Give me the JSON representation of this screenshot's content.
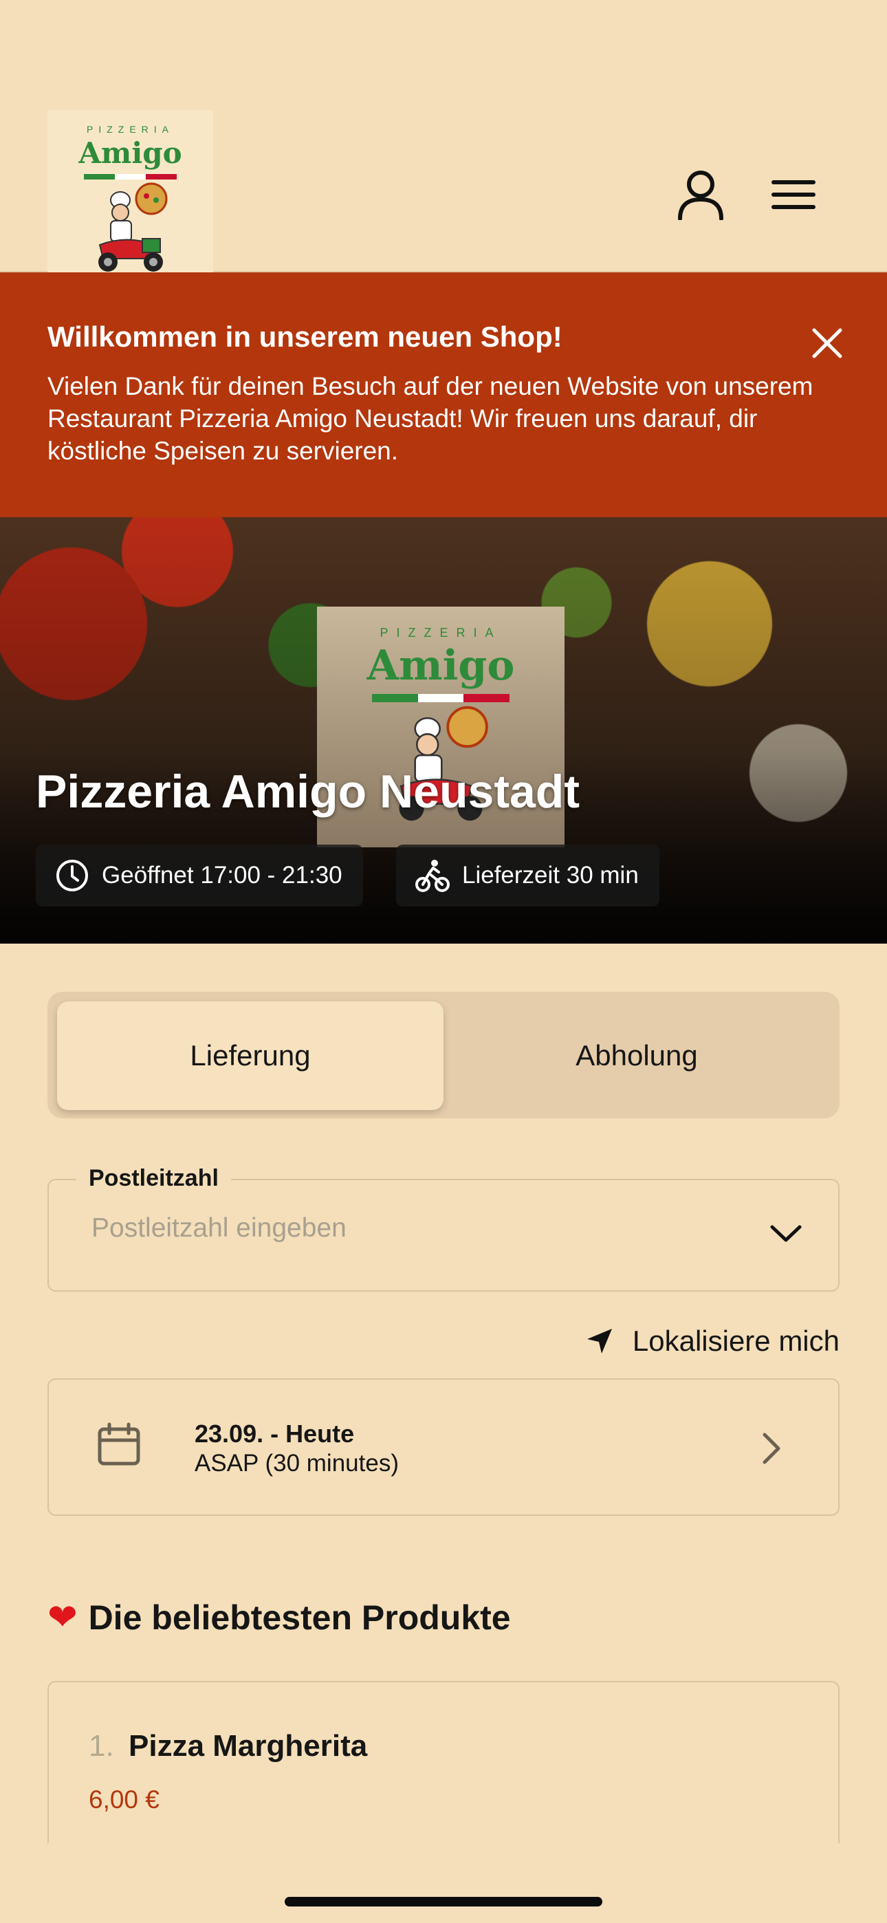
{
  "header": {
    "logo": {
      "subtitle": "PIZZERIA",
      "name": "Amigo",
      "flag_colors": [
        "#2e8b3a",
        "#ffffff",
        "#c8102e"
      ]
    },
    "account_icon": "user-icon",
    "menu_icon": "hamburger-menu-icon"
  },
  "banner": {
    "title": "Willkommen in unserem neuen Shop!",
    "text": "Vielen Dank für deinen Besuch auf der neuen Website von unserem Restaurant Pizzeria Amigo Neustadt! Wir freuen uns darauf, dir köstliche Speisen zu servieren.",
    "close_icon": "close-icon",
    "color": "#b3360c"
  },
  "hero": {
    "logo_subtitle": "PIZZERIA",
    "logo_name": "Amigo",
    "title": "Pizzeria Amigo Neustadt",
    "opening": "Geöffnet 17:00 - 21:30",
    "delivery_time": "Lieferzeit 30 min"
  },
  "order_type": {
    "options": [
      "Lieferung",
      "Abholung"
    ],
    "selected": "Lieferung"
  },
  "postcode": {
    "label": "Postleitzahl",
    "placeholder": "Postleitzahl eingeben"
  },
  "locate": {
    "label": "Lokalisiere mich"
  },
  "schedule": {
    "date": "23.09. - Heute",
    "time": "ASAP (30 minutes)"
  },
  "popular": {
    "title": "Die beliebtesten Produkte",
    "heart": "❤",
    "products": [
      {
        "rank": "1.",
        "name": "Pizza Margherita",
        "price": "6,00 €"
      }
    ]
  },
  "colors": {
    "background": "#f4dfba",
    "accent": "#b3360c",
    "logo_green": "#2e8b3a"
  }
}
